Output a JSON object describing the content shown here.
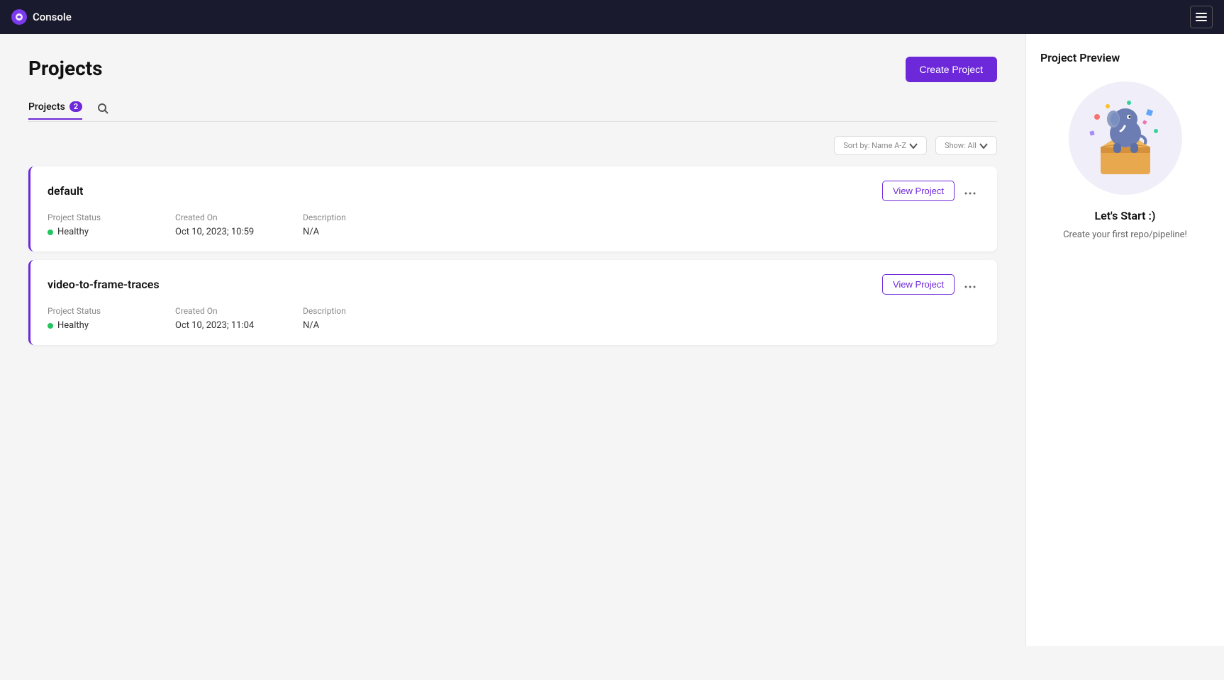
{
  "topbar": {
    "logo_text": "C",
    "title": "Console",
    "menu_aria": "Open menu"
  },
  "page": {
    "title": "Projects",
    "create_button": "Create Project"
  },
  "tabs": {
    "projects_label": "Projects",
    "projects_count": "2"
  },
  "filters": {
    "sort_label": "Sort by: Name A-Z",
    "show_label": "Show: All"
  },
  "projects": [
    {
      "name": "default",
      "status_label": "Project Status",
      "status": "Healthy",
      "status_color": "#22c55e",
      "created_label": "Created On",
      "created": "Oct 10, 2023; 10:59",
      "description_label": "Description",
      "description": "N/A",
      "view_button": "View  Project"
    },
    {
      "name": "video-to-frame-traces",
      "status_label": "Project Status",
      "status": "Healthy",
      "status_color": "#22c55e",
      "created_label": "Created On",
      "created": "Oct 10, 2023; 11:04",
      "description_label": "Description",
      "description": "N/A",
      "view_button": "View  Project"
    }
  ],
  "preview": {
    "title": "Project Preview",
    "lets_start": "Let's Start :)",
    "description": "Create your first repo/pipeline!"
  }
}
